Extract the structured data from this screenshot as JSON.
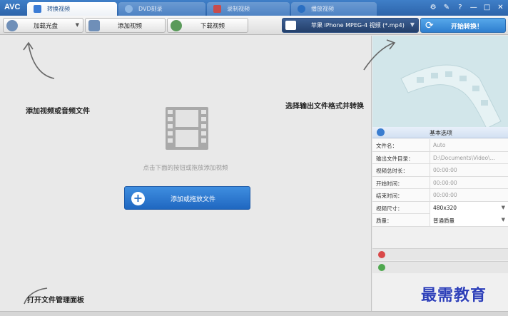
{
  "app": {
    "logo": "AVC"
  },
  "tabs": [
    {
      "label": "转换视频",
      "active": true
    },
    {
      "label": "DVD刻录",
      "active": false
    },
    {
      "label": "录制视频",
      "active": false
    },
    {
      "label": "播放视频",
      "active": false
    }
  ],
  "window_controls": {
    "minimize": "—",
    "maximize": "□",
    "close": "✕",
    "help": "?"
  },
  "toolbar": {
    "load_disc": "加载光盘",
    "add_video": "添加视频",
    "download_video": "下载视频",
    "output_format": "苹果 iPhone MPEG-4 视频 (*.mp4)",
    "convert": "开始转换！"
  },
  "main": {
    "hint_add": "添加视频或音频文件",
    "hint_format": "选择输出文件格式并转换",
    "drop_hint": "点击下面的按钮或拖放添加视频",
    "add_file_button": "添加或拖放文件",
    "hint_file_panel": "打开文件管理面板"
  },
  "properties": {
    "header": "基本选项",
    "rows": [
      {
        "key": "文件名：",
        "value": "Auto",
        "selectable": false
      },
      {
        "key": "输出文件目录：",
        "value": "D:\\Documents\\Video\\...",
        "selectable": false
      },
      {
        "key": "视频总时长：",
        "value": "00:00:00",
        "selectable": false
      },
      {
        "key": "开始时间：",
        "value": "00:00:00",
        "selectable": false
      },
      {
        "key": "结束时间：",
        "value": "00:00:00",
        "selectable": false
      },
      {
        "key": "视频尺寸：",
        "value": "480x320",
        "selectable": true
      },
      {
        "key": "质量：",
        "value": "普通质量",
        "selectable": true
      }
    ]
  },
  "watermark": "最需教育",
  "colors": {
    "tabbar": "#2d64aa",
    "accent": "#2f7fcf",
    "watermark": "#2d3fb8"
  }
}
